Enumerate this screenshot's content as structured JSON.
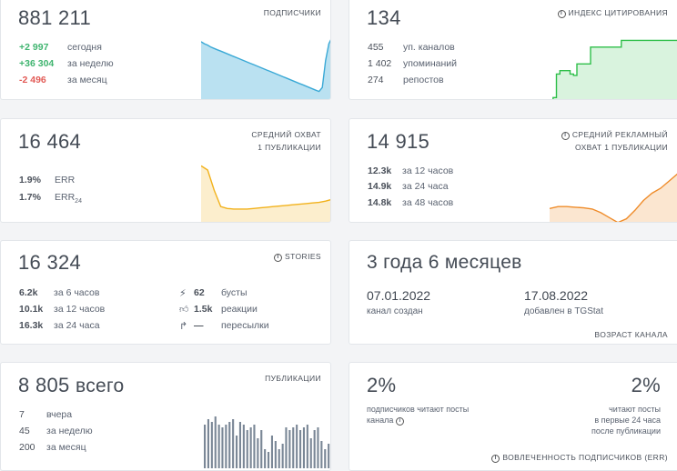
{
  "subscribers": {
    "value": "881 211",
    "label": "ПОДПИСЧИКИ",
    "rows": [
      {
        "value": "+2 997",
        "text": "сегодня",
        "tone": "green"
      },
      {
        "value": "+36 304",
        "text": "за неделю",
        "tone": "green"
      },
      {
        "value": "-2 496",
        "text": "за месяц",
        "tone": "red"
      }
    ],
    "sparkline": [
      0.12,
      0.15,
      0.17,
      0.2,
      0.22,
      0.24,
      0.26,
      0.28,
      0.3,
      0.32,
      0.34,
      0.36,
      0.38,
      0.4,
      0.42,
      0.44,
      0.46,
      0.48,
      0.5,
      0.52,
      0.54,
      0.56,
      0.58,
      0.6,
      0.62,
      0.64,
      0.66,
      0.68,
      0.7,
      0.72,
      0.74,
      0.76,
      0.78,
      0.8,
      0.82,
      0.84,
      0.86,
      0.8,
      0.4,
      0.15,
      0.05
    ],
    "color": "#3aa9d6"
  },
  "citation": {
    "value": "134",
    "label": "ИНДЕКС ЦИТИРОВАНИЯ",
    "rows": [
      {
        "value": "455",
        "text": "уп. каналов"
      },
      {
        "value": "1 402",
        "text": "упоминаний"
      },
      {
        "value": "274",
        "text": "репостов"
      }
    ],
    "steps": [
      1.0,
      0.95,
      0.6,
      0.55,
      0.55,
      0.55,
      0.6,
      0.62,
      0.45,
      0.45,
      0.45,
      0.45,
      0.2,
      0.2,
      0.2,
      0.2,
      0.2,
      0.2,
      0.2,
      0.2,
      0.2,
      0.1,
      0.1,
      0.1,
      0.1,
      0.1,
      0.1,
      0.1,
      0.1,
      0.1,
      0.1,
      0.1,
      0.1,
      0.1,
      0.1,
      0.1,
      0.1,
      0.1,
      0.1,
      0.1,
      0.1
    ],
    "color": "#2fbf4a"
  },
  "reach": {
    "value": "16 464",
    "label_line1": "СРЕДНИЙ ОХВАТ",
    "label_line2": "1 ПУБЛИКАЦИИ",
    "rows": [
      {
        "value": "1.9%",
        "text": "ERR"
      },
      {
        "value": "1.7%",
        "text": "ERR",
        "sub": "24"
      }
    ],
    "sparkline": [
      0.05,
      0.12,
      0.45,
      0.72,
      0.75,
      0.76,
      0.76,
      0.76,
      0.75,
      0.74,
      0.73,
      0.72,
      0.71,
      0.7,
      0.69,
      0.68,
      0.67,
      0.66,
      0.65,
      0.63,
      0.6
    ],
    "color": "#f2b21c"
  },
  "ad_reach": {
    "value": "14 915",
    "label_line1": "СРЕДНИЙ РЕКЛАМНЫЙ",
    "label_line2": "ОХВАТ 1 ПУБЛИКАЦИИ",
    "rows": [
      {
        "value": "12.3k",
        "text": "за 12 часов"
      },
      {
        "value": "14.9k",
        "text": "за 24 часа"
      },
      {
        "value": "14.8k",
        "text": "за 48 часов"
      }
    ],
    "sparkline": [
      0.75,
      0.72,
      0.72,
      0.73,
      0.74,
      0.76,
      0.82,
      0.9,
      0.98,
      0.92,
      0.78,
      0.62,
      0.5,
      0.42,
      0.3,
      0.18,
      0.05
    ],
    "color": "#ef8c2a"
  },
  "stories": {
    "value": "16 324",
    "label": "STORIES",
    "rows": [
      {
        "value": "6.2k",
        "text": "за 6 часов"
      },
      {
        "value": "10.1k",
        "text": "за 12 часов"
      },
      {
        "value": "16.3k",
        "text": "за 24 часа"
      }
    ],
    "right_rows": [
      {
        "icon": "boost-icon",
        "value": "62",
        "text": "бусты"
      },
      {
        "icon": "thumbs-up-icon",
        "value": "1.5k",
        "text": "реакции"
      },
      {
        "icon": "share-icon",
        "value": "—",
        "text": "пересылки"
      }
    ]
  },
  "age": {
    "value": "3 года 6 месяцев",
    "created_date": "07.01.2022",
    "created_text": "канал создан",
    "added_date": "17.08.2022",
    "added_text": "добавлен в TGStat",
    "label": "ВОЗРАСТ КАНАЛА"
  },
  "publications": {
    "value": "8 805",
    "suffix": "всего",
    "label": "ПУБЛИКАЦИИ",
    "rows": [
      {
        "value": "7",
        "text": "вчера"
      },
      {
        "value": "45",
        "text": "за неделю"
      },
      {
        "value": "200",
        "text": "за месяц"
      }
    ],
    "bars": [
      0.8,
      0.9,
      0.85,
      0.95,
      0.8,
      0.75,
      0.8,
      0.85,
      0.9,
      0.6,
      0.85,
      0.8,
      0.7,
      0.75,
      0.8,
      0.55,
      0.7,
      0.35,
      0.3,
      0.6,
      0.5,
      0.35,
      0.45,
      0.75,
      0.7,
      0.75,
      0.8,
      0.7,
      0.75,
      0.8,
      0.55,
      0.7,
      0.75,
      0.5,
      0.35,
      0.45
    ],
    "color": "#7a8796"
  },
  "engagement": {
    "left_value": "2%",
    "left_text_line1": "подписчиков читают посты",
    "left_text_line2": "канала",
    "right_value": "2%",
    "right_text_line1": "читают посты",
    "right_text_line2": "в первые 24 часа",
    "right_text_line3": "после публикации",
    "label": "ВОВЛЕЧЕННОСТЬ ПОДПИСЧИКОВ (ERR)"
  }
}
